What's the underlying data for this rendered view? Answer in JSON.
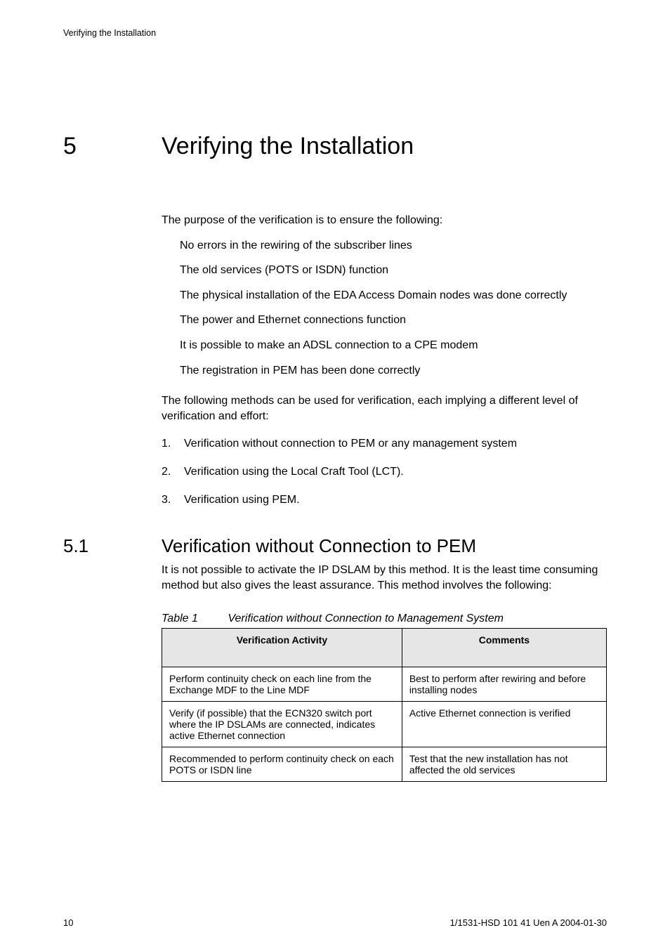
{
  "running_head": "Verifying the Installation",
  "chapter": {
    "num": "5",
    "title": "Verifying the Installation"
  },
  "intro": "The purpose of the verification is to ensure the following:",
  "bullets": [
    "No errors in the rewiring of the subscriber lines",
    "The old services (POTS or ISDN) function",
    "The physical installation of the EDA Access Domain nodes was done correctly",
    "The power and Ethernet connections function",
    "It is possible to make an ADSL connection to a CPE modem",
    "The registration in PEM has been done correctly"
  ],
  "methods_intro": "The following methods can be used for verification, each implying a different level of verification and effort:",
  "methods": [
    {
      "n": "1.",
      "text": "Verification without connection to PEM or any management system"
    },
    {
      "n": "2.",
      "text": "Verification using the Local Craft Tool (LCT)."
    },
    {
      "n": "3.",
      "text": "Verification using PEM."
    }
  ],
  "section": {
    "num": "5.1",
    "title": "Verification without Connection to PEM",
    "body": "It is not possible to activate the IP DSLAM by this method. It is the least time consuming method but also gives the least assurance. This method involves the following:"
  },
  "table": {
    "caption_label": "Table 1",
    "caption_text": "Verification without Connection to Management System",
    "headers": [
      "Verification Activity",
      "Comments"
    ],
    "rows": [
      {
        "activity": "Perform continuity check on each line from the Exchange MDF to the Line MDF",
        "comments": "Best to perform after rewiring and before installing nodes"
      },
      {
        "activity": "Verify (if possible) that the ECN320 switch port where the IP DSLAMs are connected, indicates active Ethernet connection",
        "comments": "Active Ethernet connection is verified"
      },
      {
        "activity": "Recommended to perform continuity check on each POTS or ISDN line",
        "comments": "Test that the new installation has not affected the old services"
      }
    ]
  },
  "footer": {
    "page": "10",
    "docid": "1/1531-HSD 101 41 Uen A  2004-01-30"
  }
}
